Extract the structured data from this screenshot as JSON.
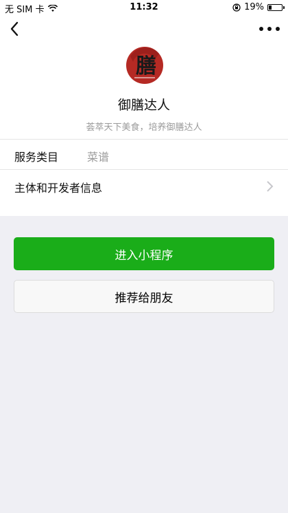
{
  "status_bar": {
    "carrier": "无 SIM 卡",
    "time": "11:32",
    "battery_percent_text": "19%",
    "battery_level": 0.19,
    "icons": [
      "wifi-icon",
      "rotation-lock-icon",
      "battery-icon"
    ]
  },
  "nav": {
    "back_icon": "chevron-left-icon",
    "more_icon": "more-dots-icon"
  },
  "profile": {
    "logo_char": "膳",
    "name": "御膳达人",
    "description": "荟萃天下美食，培养御膳达人"
  },
  "rows": {
    "service_label": "服务类目",
    "service_value": "菜谱",
    "developer_label": "主体和开发者信息"
  },
  "buttons": {
    "enter": "进入小程序",
    "recommend": "推荐给朋友"
  },
  "colors": {
    "primary_green": "#1aad19",
    "logo_red": "#b52a24",
    "background": "#efeff4"
  }
}
